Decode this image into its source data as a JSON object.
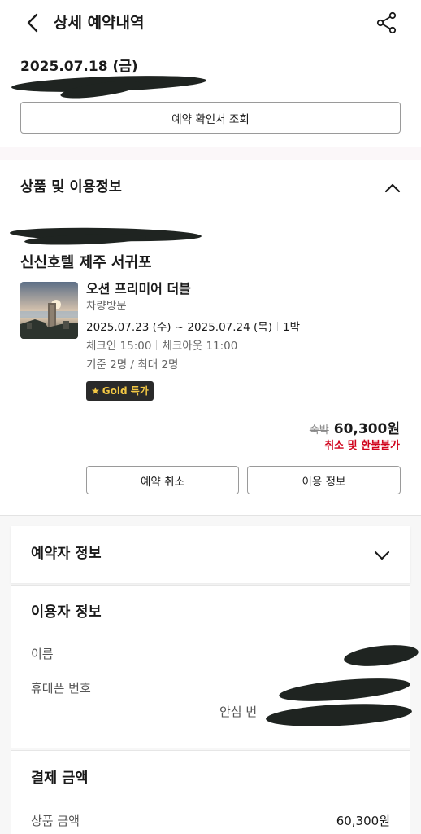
{
  "header": {
    "title": "상세 예약내역",
    "back_icon": "chevron-left-icon",
    "share_icon": "share-icon"
  },
  "reservation": {
    "date": "2025.07.18 (금)",
    "confirm_button": "예약 확인서 조회"
  },
  "product_section": {
    "title": "상품 및 이용정보",
    "collapse_icon": "chevron-up-icon",
    "hotel_name": "신신호텔 제주 서귀포",
    "room_name": "오션 프리미어 더블",
    "visit_type": "차량방문",
    "stay_dates": "2025.07.23 (수) ~ 2025.07.24 (목)",
    "nights": "1박",
    "check_in": "체크인 15:00",
    "check_out": "체크아웃 11:00",
    "capacity": "기준 2명 / 최대 2명",
    "badge": {
      "label": "Gold 특가",
      "icon": "star-icon",
      "color": "#f2c744"
    },
    "price_unit": "숙박",
    "price": "60,300원",
    "refund_policy": "취소 및 환불불가",
    "refund_color": "#d0021b",
    "cancel_button": "예약 취소",
    "info_button": "이용 정보"
  },
  "booker_section": {
    "title": "예약자 정보",
    "expand_icon": "chevron-down-icon"
  },
  "user_section": {
    "title": "이용자 정보",
    "name_label": "이름",
    "phone_label": "휴대폰 번호",
    "safe_number_label": "안심 번"
  },
  "payment_section": {
    "title": "결제 금액",
    "product_amount_label": "상품 금액",
    "product_amount": "60,300원"
  }
}
